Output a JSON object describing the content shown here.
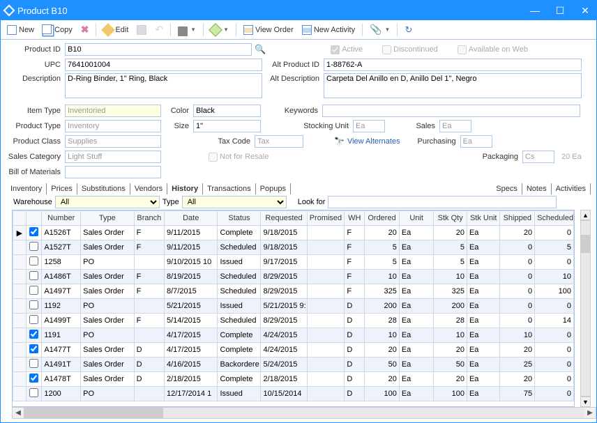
{
  "window": {
    "title": "Product B10"
  },
  "toolbar": {
    "new": "New",
    "copy": "Copy",
    "edit": "Edit",
    "view_order": "View Order",
    "new_activity": "New Activity"
  },
  "labels": {
    "product_id": "Product ID",
    "upc": "UPC",
    "description": "Description",
    "item_type": "Item Type",
    "product_type": "Product Type",
    "product_class": "Product Class",
    "sales_category": "Sales Category",
    "bill_of_materials": "Bill of Materials",
    "color": "Color",
    "size": "Size",
    "tax_code": "Tax Code",
    "not_for_resale": "Not for Resale",
    "alt_product_id": "Alt Product ID",
    "alt_description": "Alt Description",
    "keywords": "Keywords",
    "stocking_unit": "Stocking Unit",
    "sales": "Sales",
    "purchasing": "Purchasing",
    "packaging": "Packaging",
    "view_alternates": "View Alternates",
    "active": "Active",
    "discontinued": "Discontinued",
    "avail_web": "Available on Web",
    "warehouse": "Warehouse",
    "type": "Type",
    "look_for": "Look for"
  },
  "fields": {
    "product_id": "B10",
    "upc": "7641001004",
    "description": "D-Ring Binder, 1\" Ring, Black",
    "item_type": "Inventoried",
    "product_type": "Inventory",
    "product_class": "Supplies",
    "sales_category": "Light Stuff",
    "bill_of_materials": "",
    "color": "Black",
    "size": "1\"",
    "tax_code": "Tax",
    "alt_product_id": "1-88762-A",
    "alt_description": "Carpeta Del Anillo en D, Anillo Del 1\", Negro",
    "keywords": "",
    "stocking_unit": "Ea",
    "sales_unit": "Ea",
    "purchasing_unit": "Ea",
    "packaging_unit": "Cs",
    "packaging_qty": "20 Ea"
  },
  "tabs": {
    "main": [
      "Inventory",
      "Prices",
      "Substitutions",
      "Vendors",
      "History",
      "Transactions",
      "Popups"
    ],
    "active": "History",
    "side": [
      "Specs",
      "Notes",
      "Activities"
    ]
  },
  "filters": {
    "warehouse": "All",
    "type": "All",
    "look_for": ""
  },
  "grid": {
    "columns": [
      "",
      "",
      "Number",
      "Type",
      "Branch",
      "Date",
      "Status",
      "Requested",
      "Promised",
      "WH",
      "Ordered",
      "Unit",
      "Stk Qty",
      "Stk Unit",
      "Shipped",
      "Scheduled"
    ],
    "rows": [
      {
        "ptr": true,
        "chk": true,
        "num": "A1526T",
        "type": "Sales Order",
        "branch": "F",
        "date": "9/11/2015",
        "status": "Complete",
        "req": "9/18/2015",
        "prom": "",
        "wh": "F",
        "ord": "20",
        "unit": "Ea",
        "sqty": "20",
        "sunit": "Ea",
        "ship": "20",
        "sched": "0",
        "alt": false
      },
      {
        "ptr": false,
        "chk": false,
        "num": "A1527T",
        "type": "Sales Order",
        "branch": "F",
        "date": "9/11/2015",
        "status": "Scheduled",
        "req": "9/18/2015",
        "prom": "",
        "wh": "F",
        "ord": "5",
        "unit": "Ea",
        "sqty": "5",
        "sunit": "Ea",
        "ship": "0",
        "sched": "5",
        "alt": true
      },
      {
        "ptr": false,
        "chk": false,
        "num": "1258",
        "type": "PO",
        "branch": "",
        "date": "9/10/2015 10",
        "status": "Issued",
        "req": "9/17/2015",
        "prom": "",
        "wh": "F",
        "ord": "5",
        "unit": "Ea",
        "sqty": "5",
        "sunit": "Ea",
        "ship": "0",
        "sched": "0",
        "alt": false
      },
      {
        "ptr": false,
        "chk": false,
        "num": "A1486T",
        "type": "Sales Order",
        "branch": "F",
        "date": "8/19/2015",
        "status": "Scheduled",
        "req": "8/29/2015",
        "prom": "",
        "wh": "F",
        "ord": "10",
        "unit": "Ea",
        "sqty": "10",
        "sunit": "Ea",
        "ship": "0",
        "sched": "10",
        "alt": true
      },
      {
        "ptr": false,
        "chk": false,
        "num": "A1497T",
        "type": "Sales Order",
        "branch": "F",
        "date": "8/7/2015",
        "status": "Scheduled",
        "req": "8/29/2015",
        "prom": "",
        "wh": "F",
        "ord": "325",
        "unit": "Ea",
        "sqty": "325",
        "sunit": "Ea",
        "ship": "0",
        "sched": "100",
        "alt": false
      },
      {
        "ptr": false,
        "chk": false,
        "num": "1192",
        "type": "PO",
        "branch": "",
        "date": "5/21/2015",
        "status": "Issued",
        "req": "5/21/2015 9:",
        "prom": "",
        "wh": "D",
        "ord": "200",
        "unit": "Ea",
        "sqty": "200",
        "sunit": "Ea",
        "ship": "0",
        "sched": "0",
        "alt": true
      },
      {
        "ptr": false,
        "chk": false,
        "num": "A1499T",
        "type": "Sales Order",
        "branch": "F",
        "date": "5/14/2015",
        "status": "Scheduled",
        "req": "8/29/2015",
        "prom": "",
        "wh": "D",
        "ord": "28",
        "unit": "Ea",
        "sqty": "28",
        "sunit": "Ea",
        "ship": "0",
        "sched": "14",
        "alt": false
      },
      {
        "ptr": false,
        "chk": true,
        "num": "1191",
        "type": "PO",
        "branch": "",
        "date": "4/17/2015",
        "status": "Complete",
        "req": "4/24/2015",
        "prom": "",
        "wh": "D",
        "ord": "10",
        "unit": "Ea",
        "sqty": "10",
        "sunit": "Ea",
        "ship": "10",
        "sched": "0",
        "alt": true
      },
      {
        "ptr": false,
        "chk": true,
        "num": "A1477T",
        "type": "Sales Order",
        "branch": "D",
        "date": "4/17/2015",
        "status": "Complete",
        "req": "4/24/2015",
        "prom": "",
        "wh": "D",
        "ord": "20",
        "unit": "Ea",
        "sqty": "20",
        "sunit": "Ea",
        "ship": "20",
        "sched": "0",
        "alt": false
      },
      {
        "ptr": false,
        "chk": false,
        "num": "A1491T",
        "type": "Sales Order",
        "branch": "D",
        "date": "4/16/2015",
        "status": "Backordere",
        "req": "5/24/2015",
        "prom": "",
        "wh": "D",
        "ord": "50",
        "unit": "Ea",
        "sqty": "50",
        "sunit": "Ea",
        "ship": "25",
        "sched": "0",
        "alt": true
      },
      {
        "ptr": false,
        "chk": true,
        "num": "A1478T",
        "type": "Sales Order",
        "branch": "D",
        "date": "2/18/2015",
        "status": "Complete",
        "req": "2/18/2015",
        "prom": "",
        "wh": "D",
        "ord": "20",
        "unit": "Ea",
        "sqty": "20",
        "sunit": "Ea",
        "ship": "20",
        "sched": "0",
        "alt": false
      },
      {
        "ptr": false,
        "chk": false,
        "num": "1200",
        "type": "PO",
        "branch": "",
        "date": "12/17/2014 1",
        "status": "Issued",
        "req": "10/15/2014",
        "prom": "",
        "wh": "D",
        "ord": "100",
        "unit": "Ea",
        "sqty": "100",
        "sunit": "Ea",
        "ship": "75",
        "sched": "0",
        "alt": true
      }
    ]
  }
}
